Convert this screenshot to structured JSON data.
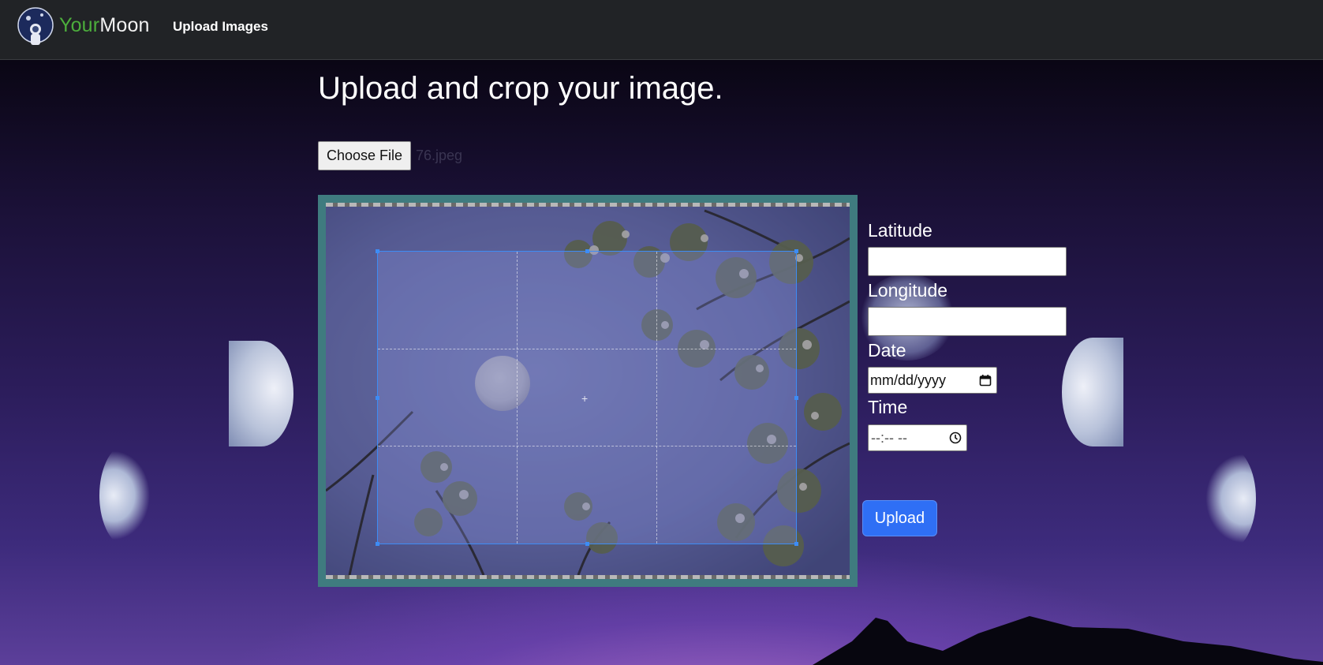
{
  "navbar": {
    "brand_your": "Your",
    "brand_moon": "Moon",
    "nav_upload": "Upload Images"
  },
  "main": {
    "title": "Upload and crop your image.",
    "choose_file_label": "Choose File",
    "file_name": "76.jpeg"
  },
  "form": {
    "latitude_label": "Latitude",
    "latitude_value": "",
    "longitude_label": "Longitude",
    "longitude_value": "",
    "date_label": "Date",
    "date_placeholder": "mm/dd/yyyy",
    "time_label": "Time",
    "time_placeholder": "--:-- --",
    "upload_label": "Upload"
  },
  "icons": {
    "logo": "astronaut-moon-logo",
    "calendar": "calendar-icon",
    "clock": "clock-icon"
  },
  "colors": {
    "navbar_bg": "#212326",
    "brand_green": "#4cae3c",
    "upload_button": "#2f6ff5",
    "cropper_frame": "#3f7b7f",
    "crop_handle": "#3d8cf5"
  }
}
